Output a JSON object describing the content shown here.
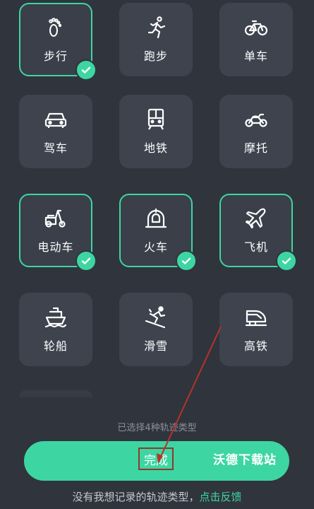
{
  "accent_color": "#3dd6a2",
  "tiles": [
    {
      "label": "步行",
      "icon": "footprints-icon",
      "selected": true
    },
    {
      "label": "跑步",
      "icon": "runner-icon",
      "selected": false
    },
    {
      "label": "单车",
      "icon": "bicycle-icon",
      "selected": false
    },
    {
      "label": "驾车",
      "icon": "car-icon",
      "selected": false
    },
    {
      "label": "地铁",
      "icon": "subway-icon",
      "selected": false
    },
    {
      "label": "摩托",
      "icon": "motorcycle-icon",
      "selected": false
    },
    {
      "label": "电动车",
      "icon": "scooter-icon",
      "selected": true
    },
    {
      "label": "火车",
      "icon": "train-icon",
      "selected": true
    },
    {
      "label": "飞机",
      "icon": "airplane-icon",
      "selected": true
    },
    {
      "label": "轮船",
      "icon": "ship-icon",
      "selected": false
    },
    {
      "label": "滑雪",
      "icon": "skier-icon",
      "selected": false
    },
    {
      "label": "高铁",
      "icon": "bullet-train-icon",
      "selected": false
    }
  ],
  "status_text": "已选择4种轨迹类型",
  "done_label": "完成",
  "watermark": "沃德下载站",
  "footer": {
    "prefix": "没有我想记录的轨迹类型，",
    "link": "点击反馈"
  }
}
